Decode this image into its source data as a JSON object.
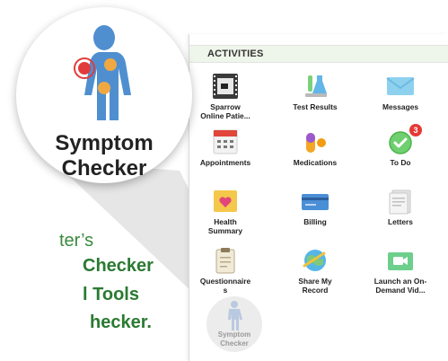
{
  "section": {
    "title": "ACTIVITIES"
  },
  "items": [
    {
      "label": "Sparrow\nOnline Patie...",
      "icon": "film-icon"
    },
    {
      "label": "Test Results",
      "icon": "flask-icon"
    },
    {
      "label": "Messages",
      "icon": "envelope-icon"
    },
    {
      "label": "Appointments",
      "icon": "calendar-icon"
    },
    {
      "label": "Medications",
      "icon": "pill-icon"
    },
    {
      "label": "To Do",
      "icon": "checkmark-icon",
      "badge": "3"
    },
    {
      "label": "Health\nSummary",
      "icon": "heart-folder-icon"
    },
    {
      "label": "Billing",
      "icon": "credit-card-icon"
    },
    {
      "label": "Letters",
      "icon": "letters-icon"
    },
    {
      "label": "Questionnaire\ns",
      "icon": "clipboard-icon"
    },
    {
      "label": "Share My\nRecord",
      "icon": "globe-share-icon"
    },
    {
      "label": "Launch an On-\nDemand Vid...",
      "icon": "video-icon"
    }
  ],
  "symptom_checker": {
    "label": "Symptom\nChecker"
  },
  "callout": {
    "label": "Symptom\nChecker"
  },
  "side_text": {
    "line1": "ter’s",
    "line2": "Checker",
    "line3": "l Tools",
    "line4": "hecker."
  },
  "colors": {
    "accent_green": "#2a7a31",
    "header_bg": "#eef5ea",
    "badge_red": "#e53935"
  }
}
